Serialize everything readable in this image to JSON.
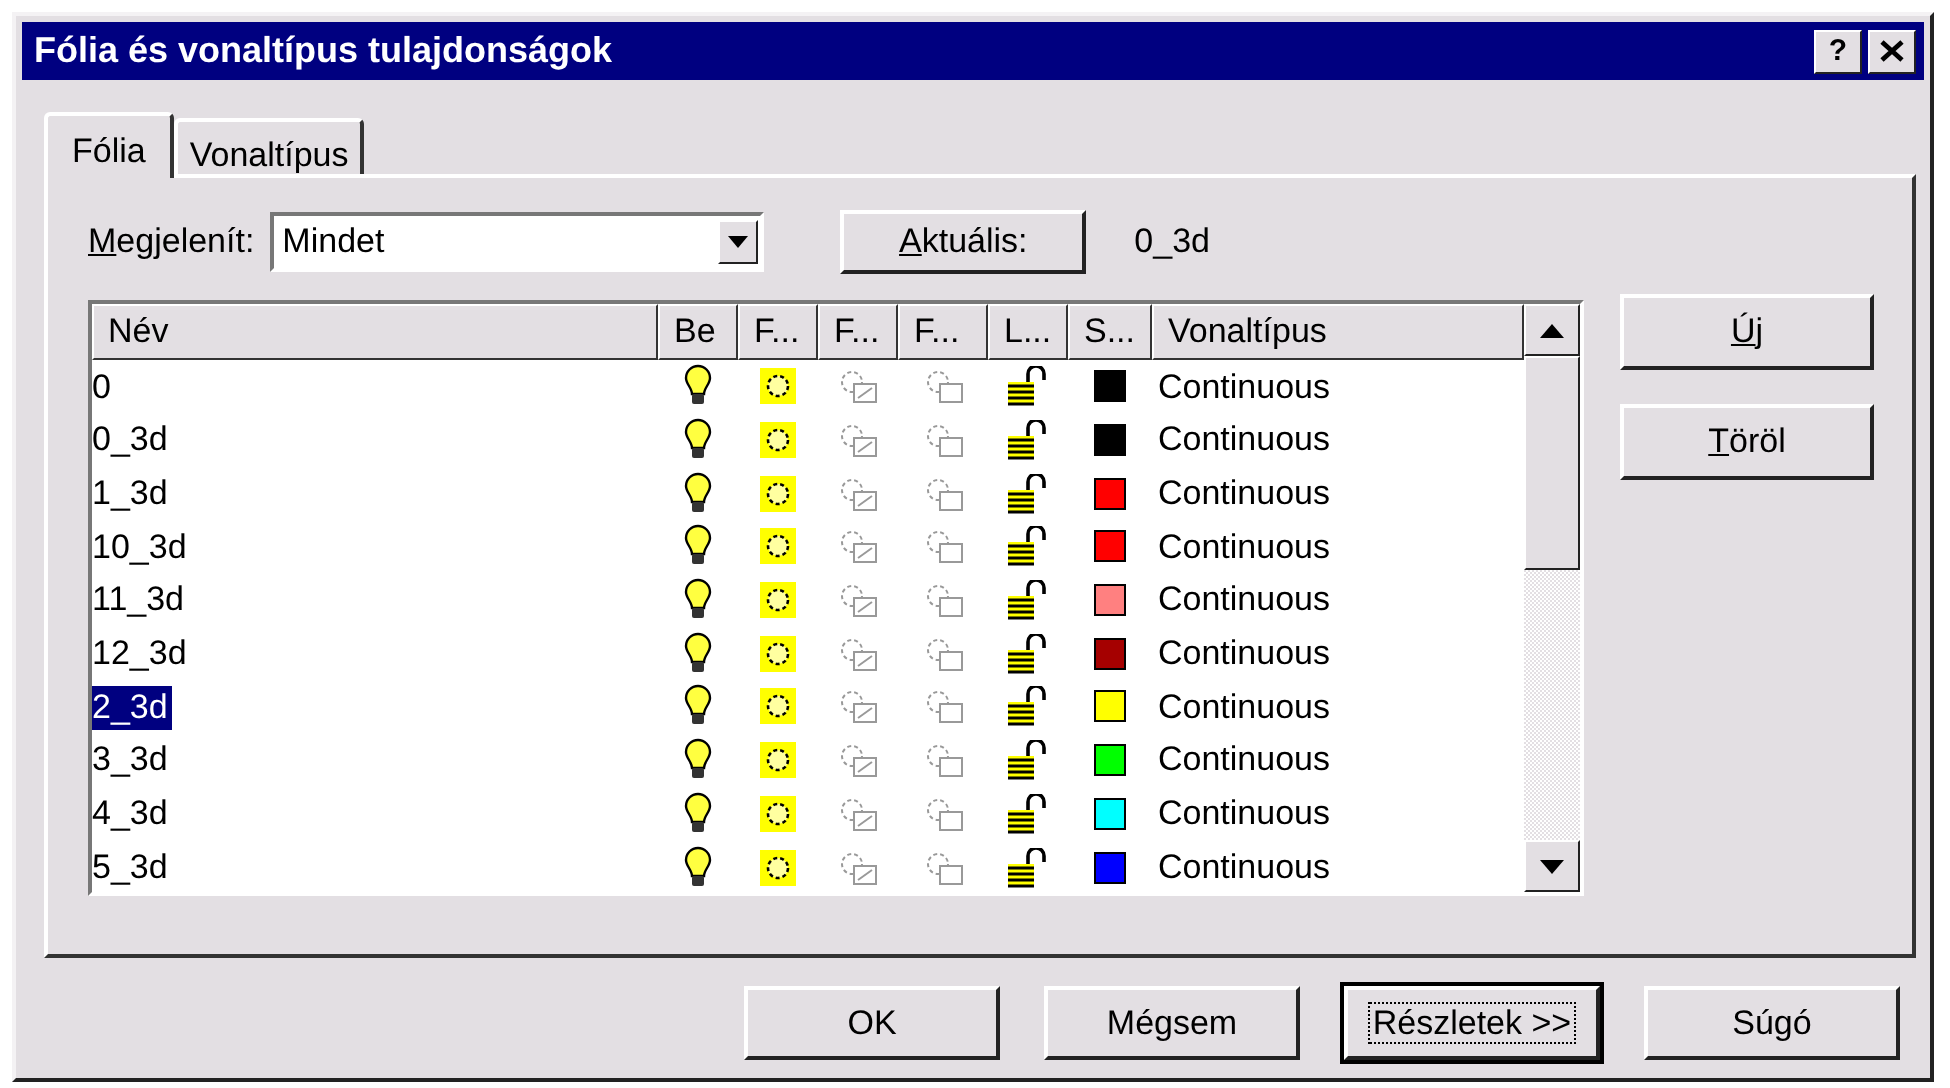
{
  "window": {
    "title": "Fólia és vonaltípus tulajdonságok",
    "buttons": [
      {
        "kind": "help",
        "label": "?"
      },
      {
        "kind": "close"
      }
    ]
  },
  "tabs": [
    {
      "label": "Fólia",
      "selected": true
    },
    {
      "label": "Vonaltípus",
      "selected": false
    }
  ],
  "filter": {
    "label": "Megjelenít:",
    "underline_first": true,
    "value": "Mindet"
  },
  "current": {
    "button": "Aktuális:",
    "underline_first": true,
    "value": "0_3d"
  },
  "table": {
    "columns": [
      "Név",
      "Be",
      "F...",
      "F...",
      "F...",
      "L...",
      "S...",
      "Vonaltípus"
    ],
    "rows": [
      {
        "name": "0",
        "on": true,
        "frozen": false,
        "locked": false,
        "color": "#000000",
        "linetype": "Continuous",
        "selected": false
      },
      {
        "name": "0_3d",
        "on": true,
        "frozen": false,
        "locked": false,
        "color": "#000000",
        "linetype": "Continuous",
        "selected": false
      },
      {
        "name": "1_3d",
        "on": true,
        "frozen": false,
        "locked": false,
        "color": "#ff0000",
        "linetype": "Continuous",
        "selected": false
      },
      {
        "name": "10_3d",
        "on": true,
        "frozen": false,
        "locked": false,
        "color": "#ff0000",
        "linetype": "Continuous",
        "selected": false
      },
      {
        "name": "11_3d",
        "on": true,
        "frozen": false,
        "locked": false,
        "color": "#ff8080",
        "linetype": "Continuous",
        "selected": false
      },
      {
        "name": "12_3d",
        "on": true,
        "frozen": false,
        "locked": false,
        "color": "#a50000",
        "linetype": "Continuous",
        "selected": false
      },
      {
        "name": "2_3d",
        "on": true,
        "frozen": false,
        "locked": false,
        "color": "#ffff00",
        "linetype": "Continuous",
        "selected": true
      },
      {
        "name": "3_3d",
        "on": true,
        "frozen": false,
        "locked": false,
        "color": "#00ff00",
        "linetype": "Continuous",
        "selected": false
      },
      {
        "name": "4_3d",
        "on": true,
        "frozen": false,
        "locked": false,
        "color": "#00ffff",
        "linetype": "Continuous",
        "selected": false
      },
      {
        "name": "5_3d",
        "on": true,
        "frozen": false,
        "locked": false,
        "color": "#0000ff",
        "linetype": "Continuous",
        "selected": false
      }
    ]
  },
  "side_buttons": [
    {
      "label": "Új",
      "underline_first": true
    },
    {
      "label": "Töröl",
      "underline_first": true
    }
  ],
  "footer_buttons": [
    {
      "label": "OK",
      "focused": false
    },
    {
      "label": "Mégsem",
      "focused": false
    },
    {
      "label": "Részletek >>",
      "focused": true
    },
    {
      "label": "Súgó",
      "focused": false
    }
  ]
}
